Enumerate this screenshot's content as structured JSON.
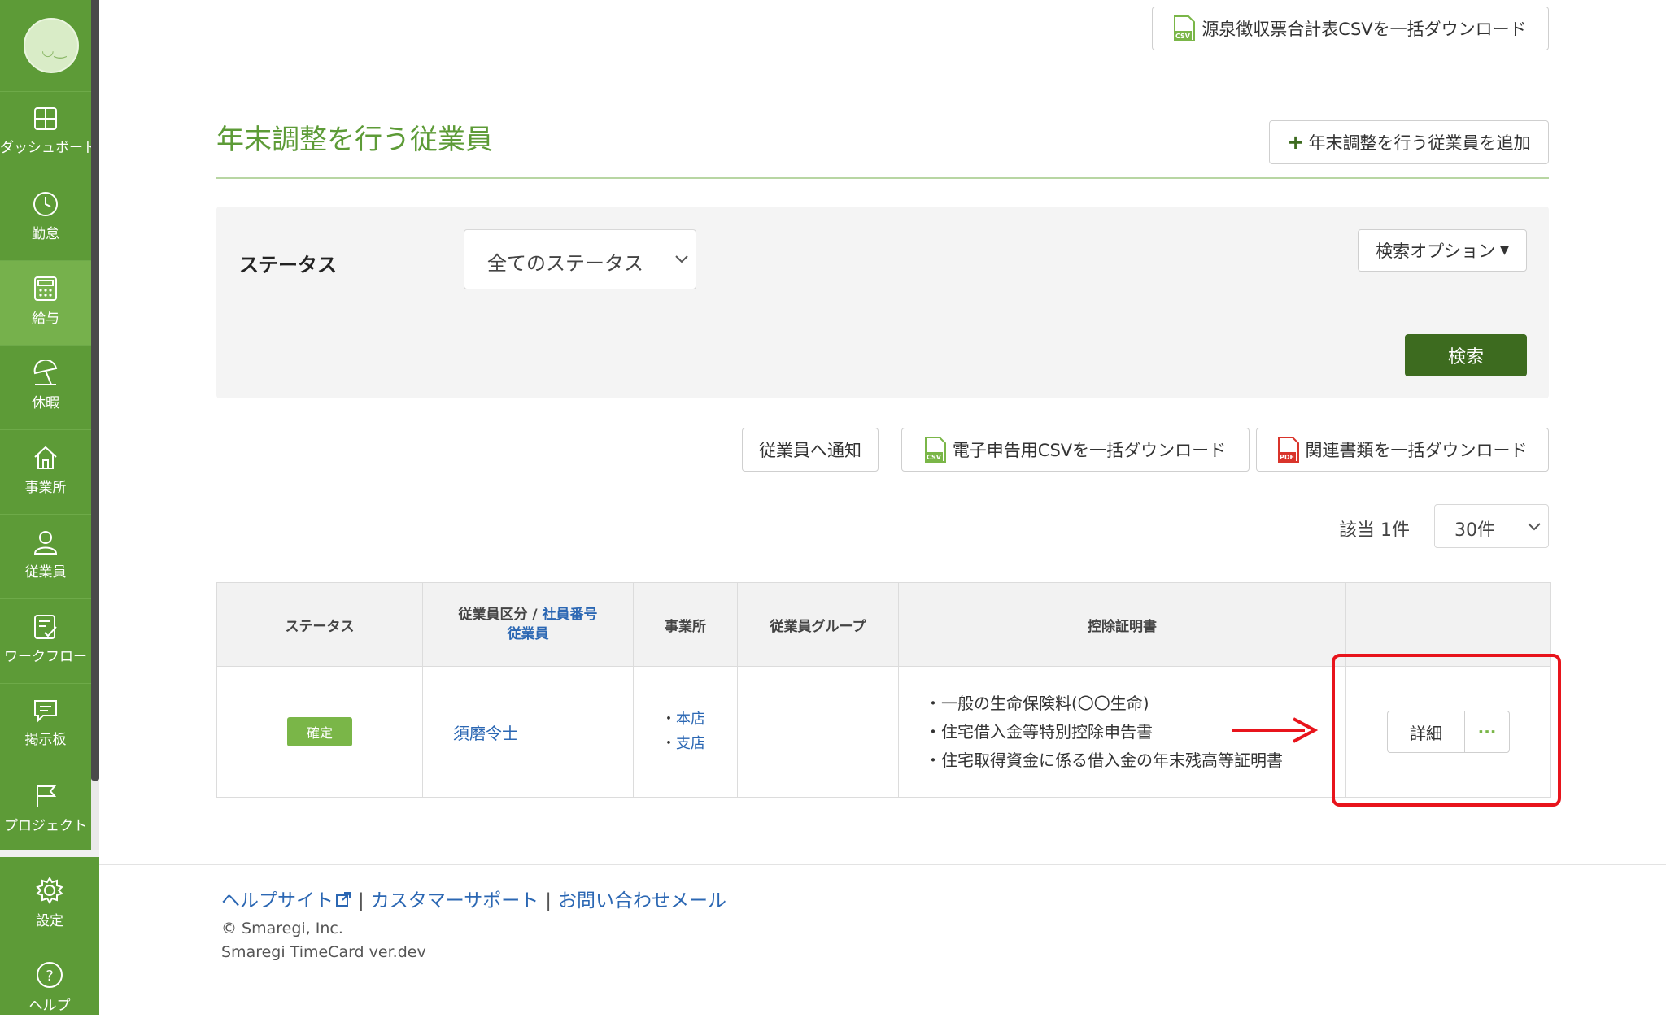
{
  "sidebar": {
    "items": [
      {
        "label": "ダッシュボード",
        "icon": "dashboard-icon"
      },
      {
        "label": "勤怠",
        "icon": "clock-icon"
      },
      {
        "label": "給与",
        "icon": "calculator-icon"
      },
      {
        "label": "休暇",
        "icon": "beach-umbrella-icon"
      },
      {
        "label": "事業所",
        "icon": "home-icon"
      },
      {
        "label": "従業員",
        "icon": "person-icon"
      },
      {
        "label": "ワークフロー",
        "icon": "checklist-icon"
      },
      {
        "label": "掲示板",
        "icon": "message-board-icon"
      },
      {
        "label": "プロジェクト",
        "icon": "flag-icon"
      }
    ],
    "bottom_items": [
      {
        "label": "設定",
        "icon": "gear-icon"
      },
      {
        "label": "ヘルプ",
        "icon": "help-icon"
      }
    ]
  },
  "header": {
    "csv_total_button": "源泉徴収票合計表CSVを一括ダウンロード",
    "add_employee_button": "年末調整を行う従業員を追加"
  },
  "page_title": "年末調整を行う従業員",
  "search": {
    "status_label": "ステータス",
    "status_selected": "全てのステータス",
    "options_button": "検索オプション",
    "search_button": "検索"
  },
  "actions": {
    "notify_button": "従業員へ通知",
    "e_filing_csv_button": "電子申告用CSVを一括ダウンロード",
    "docs_download_button": "関連書類を一括ダウンロード"
  },
  "result": {
    "count_text": "該当 1件",
    "per_page": "30件"
  },
  "table": {
    "headers": {
      "status": "ステータス",
      "category_prefix": "従業員区分 / ",
      "employee_no": "社員番号",
      "employee": "従業員",
      "office": "事業所",
      "group": "従業員グループ",
      "certificates": "控除証明書"
    },
    "rows": [
      {
        "status": "確定",
        "employee": "須磨令士",
        "offices": [
          "本店",
          "支店"
        ],
        "group": "",
        "certificates": [
          "一般の生命保険料(〇〇生命)",
          "住宅借入金等特別控除申告書",
          "住宅取得資金に係る借入金の年末残高等証明書"
        ],
        "detail_button": "詳細",
        "more_button": "···"
      }
    ]
  },
  "footer": {
    "help_site": "ヘルプサイト",
    "support": "カスタマーサポート",
    "contact": "お問い合わせメール",
    "separator": "|",
    "copyright": "© Smaregi, Inc.",
    "version": "Smaregi TimeCard ver.dev"
  },
  "colors": {
    "brand_green": "#5d9b37",
    "title_green": "#5d9b37",
    "search_button": "#3d6b1f",
    "badge": "#7ab648",
    "link": "#2b67b3",
    "highlight_red": "#e8141c"
  }
}
